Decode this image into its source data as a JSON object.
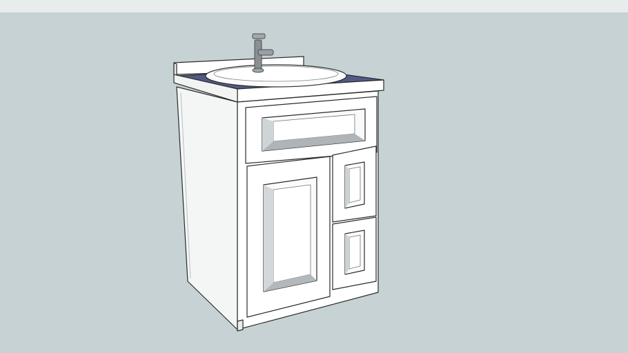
{
  "viewport": {
    "background_color": "#c6d2d4",
    "top_strip_color": "#e9eced"
  },
  "model": {
    "parts": [
      "backsplash",
      "countertop",
      "sink-basin",
      "faucet",
      "cabinet-side-panel",
      "cabinet-face-frame",
      "top-drawer",
      "cabinet-door",
      "small-drawer-upper",
      "small-drawer-lower",
      "toe-kick"
    ],
    "colors": {
      "cabinet": "#ffffff",
      "cabinet_shadow": "#eef0f0",
      "panel_bevel": "#9aa2a6",
      "outline": "#2a2a2a",
      "countertop_surface": "#515a86",
      "sink": "#fbfbfb",
      "faucet": "#8a8f93"
    }
  }
}
